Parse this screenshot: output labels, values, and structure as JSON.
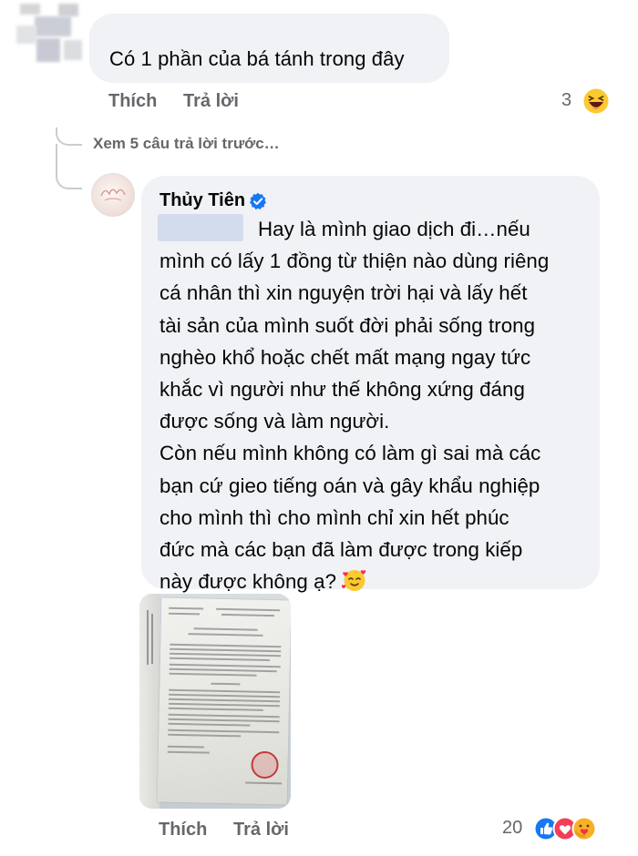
{
  "comment_top": {
    "text": "Có 1 phần của bá tánh trong đây",
    "actions": {
      "like": "Thích",
      "reply": "Trả lời"
    },
    "reaction_count": "3",
    "reaction_icon": "haha-emoji-icon"
  },
  "thread": {
    "view_previous": "Xem 5 câu trả lời trước…"
  },
  "reply": {
    "author": "Thủy Tiên",
    "verified_icon": "verified-badge-icon",
    "lines": [
      "Hay là mình giao dịch đi…nếu",
      "mình có lấy 1 đồng từ thiện nào dùng riêng",
      "cá nhân thì xin nguyện trời hại và lấy hết",
      "tài sản của mình suốt đời phải sống trong",
      "nghèo khổ hoặc  chết mất mạng ngay tức",
      "khắc vì người như thế không xứng đáng",
      "được sống và làm người.",
      "Còn nếu mình không có làm gì sai mà các",
      "bạn cứ gieo tiếng oán và gây khẩu nghiệp",
      "cho mình thì cho mình chỉ xin hết phúc",
      "đức mà các bạn đã làm được trong kiếp",
      "này được không ạ?"
    ],
    "end_emoji": "smiling-face-with-hearts-icon",
    "attachment": "document-photo",
    "actions": {
      "like": "Thích",
      "reply": "Trả lời"
    },
    "reaction_count": "20",
    "reaction_icons": [
      "like-icon",
      "love-icon",
      "care-icon"
    ]
  },
  "colors": {
    "bubble": "#f0f2f5",
    "secondary_text": "#65676b",
    "verified_blue": "#1877f2"
  }
}
